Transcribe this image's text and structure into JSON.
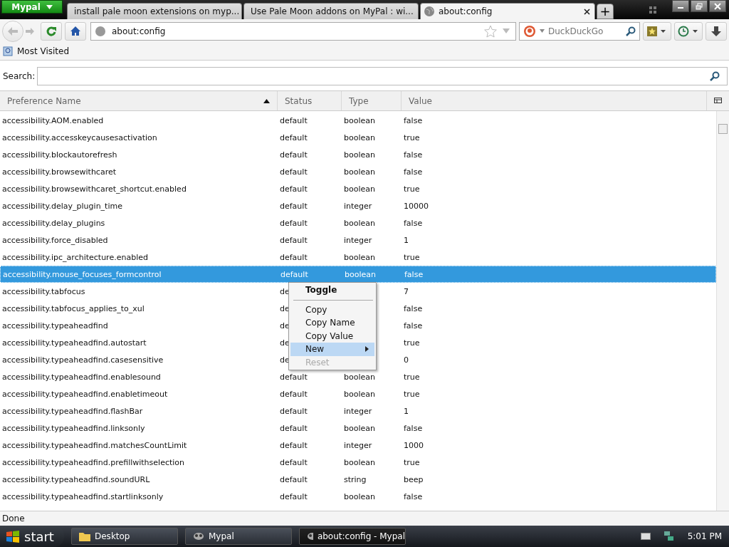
{
  "app_button": {
    "label": "Mypal"
  },
  "tabs": [
    {
      "title": "install pale moon extensions on myp...",
      "selected": false
    },
    {
      "title": "Use Pale Moon addons on MyPal : wi...",
      "selected": false
    },
    {
      "title": "about:config",
      "selected": true
    }
  ],
  "new_tab": {
    "label": "+"
  },
  "address": {
    "value": "about:config"
  },
  "search_engine": {
    "placeholder": "DuckDuckGo"
  },
  "bookmarks": [
    {
      "label": "Most Visited"
    }
  ],
  "filter": {
    "label": "Search:"
  },
  "columns": [
    {
      "label": "Preference Name",
      "sorted": true
    },
    {
      "label": "Status",
      "sorted": false
    },
    {
      "label": "Type",
      "sorted": false
    },
    {
      "label": "Value",
      "sorted": false
    }
  ],
  "rows": [
    {
      "name": "accessibility.AOM.enabled",
      "status": "default",
      "type": "boolean",
      "value": "false",
      "selected": false
    },
    {
      "name": "accessibility.accesskeycausesactivation",
      "status": "default",
      "type": "boolean",
      "value": "true",
      "selected": false
    },
    {
      "name": "accessibility.blockautorefresh",
      "status": "default",
      "type": "boolean",
      "value": "false",
      "selected": false
    },
    {
      "name": "accessibility.browsewithcaret",
      "status": "default",
      "type": "boolean",
      "value": "false",
      "selected": false
    },
    {
      "name": "accessibility.browsewithcaret_shortcut.enabled",
      "status": "default",
      "type": "boolean",
      "value": "true",
      "selected": false
    },
    {
      "name": "accessibility.delay_plugin_time",
      "status": "default",
      "type": "integer",
      "value": "10000",
      "selected": false
    },
    {
      "name": "accessibility.delay_plugins",
      "status": "default",
      "type": "boolean",
      "value": "false",
      "selected": false
    },
    {
      "name": "accessibility.force_disabled",
      "status": "default",
      "type": "integer",
      "value": "1",
      "selected": false
    },
    {
      "name": "accessibility.ipc_architecture.enabled",
      "status": "default",
      "type": "boolean",
      "value": "true",
      "selected": false
    },
    {
      "name": "accessibility.mouse_focuses_formcontrol",
      "status": "default",
      "type": "boolean",
      "value": "false",
      "selected": true
    },
    {
      "name": "accessibility.tabfocus",
      "status": "de",
      "value": "7",
      "selected": false
    },
    {
      "name": "accessibility.tabfocus_applies_to_xul",
      "status": "de",
      "value": "false",
      "selected": false
    },
    {
      "name": "accessibility.typeaheadfind",
      "status": "de",
      "value": "false",
      "selected": false
    },
    {
      "name": "accessibility.typeaheadfind.autostart",
      "status": "de",
      "value": "true",
      "selected": false
    },
    {
      "name": "accessibility.typeaheadfind.casesensitive",
      "status": "de",
      "value": "0",
      "selected": false
    },
    {
      "name": "accessibility.typeaheadfind.enablesound",
      "status": "default",
      "type": "boolean",
      "value": "true",
      "selected": false
    },
    {
      "name": "accessibility.typeaheadfind.enabletimeout",
      "status": "default",
      "type": "boolean",
      "value": "true",
      "selected": false
    },
    {
      "name": "accessibility.typeaheadfind.flashBar",
      "status": "default",
      "type": "integer",
      "value": "1",
      "selected": false
    },
    {
      "name": "accessibility.typeaheadfind.linksonly",
      "status": "default",
      "type": "boolean",
      "value": "false",
      "selected": false
    },
    {
      "name": "accessibility.typeaheadfind.matchesCountLimit",
      "status": "default",
      "type": "integer",
      "value": "1000",
      "selected": false
    },
    {
      "name": "accessibility.typeaheadfind.prefillwithselection",
      "status": "default",
      "type": "boolean",
      "value": "true",
      "selected": false
    },
    {
      "name": "accessibility.typeaheadfind.soundURL",
      "status": "default",
      "type": "string",
      "value": "beep",
      "selected": false
    },
    {
      "name": "accessibility.typeaheadfind.startlinksonly",
      "status": "default",
      "type": "boolean",
      "value": "false",
      "selected": false
    }
  ],
  "context_menu": [
    {
      "kind": "item",
      "label": "Toggle",
      "bold": true,
      "disabled": false,
      "selected": false
    },
    {
      "kind": "separator"
    },
    {
      "kind": "item",
      "label": "Copy",
      "bold": false,
      "disabled": false,
      "selected": false
    },
    {
      "kind": "item",
      "label": "Copy Name",
      "bold": false,
      "disabled": false,
      "selected": false
    },
    {
      "kind": "item",
      "label": "Copy Value",
      "bold": false,
      "disabled": false,
      "selected": false
    },
    {
      "kind": "submenu",
      "label": "New",
      "bold": false,
      "disabled": false,
      "selected": true
    },
    {
      "kind": "item",
      "label": "Reset",
      "bold": false,
      "disabled": true,
      "selected": false
    }
  ],
  "status_bar": {
    "text": "Done"
  },
  "taskbar": {
    "start": "start",
    "buttons": [
      {
        "label": "Desktop",
        "selected": false
      },
      {
        "label": "Mypal",
        "selected": false
      },
      {
        "label": "about:config - Mypal",
        "selected": true
      }
    ],
    "clock": "5:01 PM"
  }
}
